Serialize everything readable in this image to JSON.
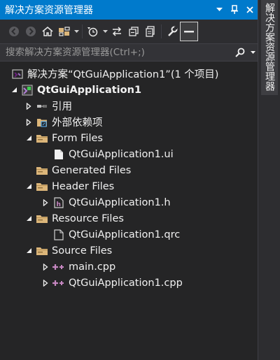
{
  "panel": {
    "title": "解决方案资源管理器"
  },
  "titlebar_buttons": [
    "dropdown-icon",
    "pin-icon",
    "close-icon"
  ],
  "toolbar": {
    "tools": [
      "back-icon",
      "forward-icon",
      "home-icon",
      "switch-views-icon",
      "dropdown-icon",
      "pending-changes-filter-icon",
      "dropdown-icon",
      "sync-with-active-document-icon",
      "collapse-all-icon",
      "show-all-files-icon",
      "properties-icon",
      "preview-selected-items-icon"
    ]
  },
  "search": {
    "placeholder": "搜索解决方案资源管理器(Ctrl+;)"
  },
  "tree": [
    {
      "label": "解决方案“QtGuiApplication1”(1 个项目)",
      "icon": "solution-icon",
      "arrow": "none",
      "level": 0
    },
    {
      "label": "QtGuiApplication1",
      "icon": "qt-project-icon",
      "arrow": "expanded",
      "level": 0,
      "bold": true
    },
    {
      "label": "引用",
      "icon": "references-icon",
      "arrow": "collapsed",
      "level": 1
    },
    {
      "label": "外部依赖项",
      "icon": "external-dependencies-icon",
      "arrow": "collapsed",
      "level": 1
    },
    {
      "label": "Form Files",
      "icon": "filter-folder-icon",
      "arrow": "expanded",
      "level": 1
    },
    {
      "label": "QtGuiApplication1.ui",
      "icon": "ui-file-icon",
      "arrow": "none",
      "level": 2
    },
    {
      "label": "Generated Files",
      "icon": "filter-folder-icon",
      "arrow": "none",
      "level": 1
    },
    {
      "label": "Header Files",
      "icon": "filter-folder-icon",
      "arrow": "expanded",
      "level": 1
    },
    {
      "label": "QtGuiApplication1.h",
      "icon": "header-file-icon",
      "arrow": "collapsed",
      "level": 2
    },
    {
      "label": "Resource Files",
      "icon": "filter-folder-icon",
      "arrow": "expanded",
      "level": 1
    },
    {
      "label": "QtGuiApplication1.qrc",
      "icon": "resource-file-icon",
      "arrow": "none",
      "level": 2
    },
    {
      "label": "Source Files",
      "icon": "filter-folder-icon",
      "arrow": "expanded",
      "level": 1
    },
    {
      "label": "main.cpp",
      "icon": "cpp-file-icon",
      "arrow": "collapsed",
      "level": 2
    },
    {
      "label": "QtGuiApplication1.cpp",
      "icon": "cpp-file-icon",
      "arrow": "collapsed",
      "level": 2
    }
  ],
  "side_tab": {
    "label": "解决方案资源管理器"
  },
  "colors": {
    "accent": "#007acc",
    "background": "#252526",
    "toolbar": "#2d2d30",
    "text": "#f1f1f1",
    "folder": "#dcb67a",
    "cpp": "#c586c0"
  }
}
